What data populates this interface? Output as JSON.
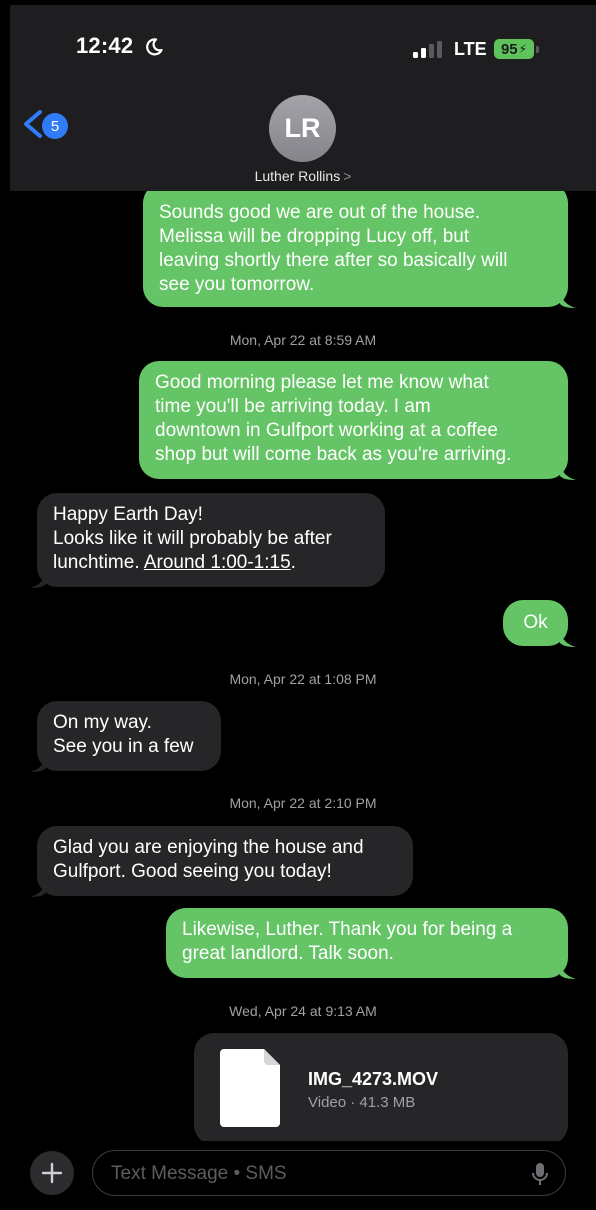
{
  "status_bar": {
    "time": "12:42",
    "network": "LTE",
    "battery": "95"
  },
  "header": {
    "back_badge": "5",
    "avatar_initials": "LR",
    "contact_name": "Luther Rollins",
    "contact_chevron": ">"
  },
  "messages": {
    "m1": [
      "Sounds good we are out of the house.",
      "Melissa will be dropping Lucy off, but",
      "leaving shortly there after so basically will",
      "see you tomorrow."
    ],
    "ts1": {
      "day": "Mon, Apr 22",
      "at": "at",
      "time": "8:59 AM"
    },
    "m2": [
      "Good morning please let me know what",
      "time you'll be arriving today. I am",
      "downtown in Gulfport working at a coffee",
      "shop but will come back as you're arriving."
    ],
    "m3": {
      "line1": "Happy Earth Day!",
      "line2": "Looks like it will probably be after",
      "line3_prefix": "lunchtime. ",
      "line3_link": "Around 1:00-1:15",
      "line3_suffix": "."
    },
    "m4": "Ok",
    "ts2": {
      "day": "Mon, Apr 22",
      "at": "at",
      "time": "1:08 PM"
    },
    "m5": [
      "On my way.",
      "See you in a few"
    ],
    "ts3": {
      "day": "Mon, Apr 22",
      "at": "at",
      "time": "2:10 PM"
    },
    "m6": [
      "Glad you are enjoying the house and",
      "Gulfport. Good seeing you today!"
    ],
    "m7": [
      "Likewise, Luther. Thank you for being a",
      "great landlord. Talk soon."
    ],
    "ts4": {
      "day": "Wed, Apr 24",
      "at": "at",
      "time": "9:13 AM"
    },
    "attachment": {
      "name": "IMG_4273.MOV",
      "meta": "Video · 41.3 MB"
    }
  },
  "input": {
    "placeholder": "Text Message • SMS"
  },
  "colors": {
    "sent_bubble": "#65c466",
    "received_bubble": "#262628",
    "accent": "#2f7cf6"
  },
  "icons": [
    "moon-icon",
    "signal-icon",
    "back-chevron-icon",
    "file-icon",
    "plus-icon",
    "mic-icon"
  ]
}
